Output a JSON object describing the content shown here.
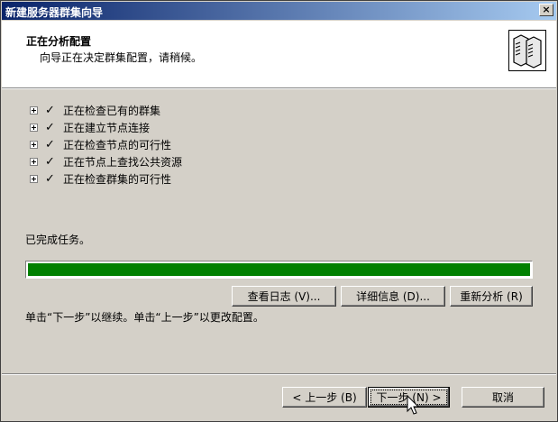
{
  "window": {
    "title": "新建服务器群集向导",
    "close_label": "×"
  },
  "header": {
    "title": "正在分析配置",
    "subtitle": "向导正在决定群集配置，请稍候。",
    "icon": "server-cluster-icon"
  },
  "tasks": [
    {
      "label": "正在检查已有的群集",
      "status": "done"
    },
    {
      "label": "正在建立节点连接",
      "status": "done"
    },
    {
      "label": "正在检查节点的可行性",
      "status": "done"
    },
    {
      "label": "正在节点上查找公共资源",
      "status": "done"
    },
    {
      "label": "正在检查群集的可行性",
      "status": "done"
    }
  ],
  "check_glyph": "✓",
  "status_text": "已完成任务。",
  "progress": {
    "percent": 100,
    "color": "#008000"
  },
  "action_buttons": {
    "view_log": "查看日志 (V)...",
    "details": "详细信息 (D)...",
    "reanalyze": "重新分析 (R)"
  },
  "instruction": "单击“下一步”以继续。单击“上一步”以更改配置。",
  "nav_buttons": {
    "back": "< 上一步 (B)",
    "next": "下一步 (N) >",
    "cancel": "取消"
  }
}
